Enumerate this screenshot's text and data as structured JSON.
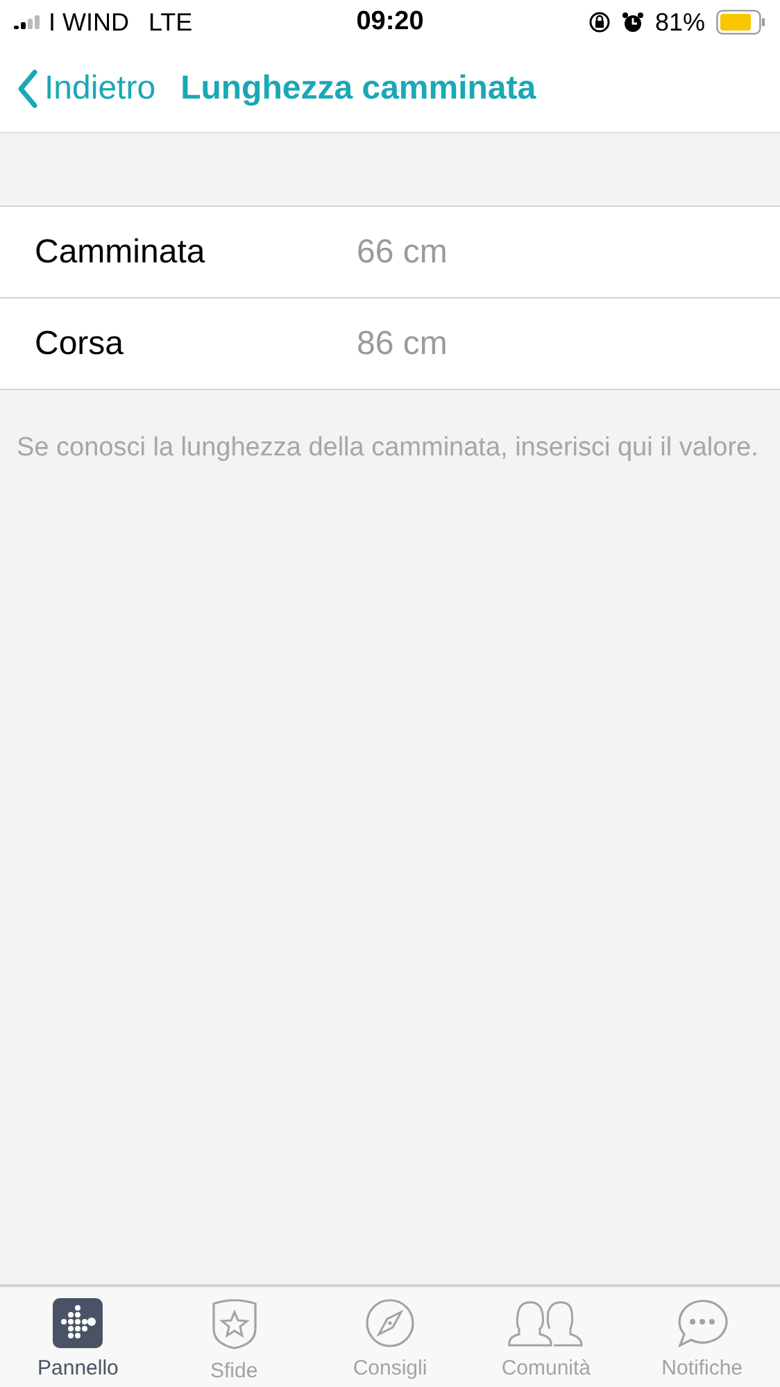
{
  "status_bar": {
    "carrier": "I WIND",
    "network": "LTE",
    "time": "09:20",
    "battery": "81%"
  },
  "nav": {
    "back": "Indietro",
    "title": "Lunghezza camminata"
  },
  "rows": [
    {
      "label": "Camminata",
      "value": "66 cm"
    },
    {
      "label": "Corsa",
      "value": "86 cm"
    }
  ],
  "note": "Se conosci la lunghezza della camminata, inserisci qui il valore.",
  "tabs": [
    {
      "label": "Pannello",
      "kind": "dashboard",
      "selected": true
    },
    {
      "label": "Sfide",
      "kind": "challenges",
      "selected": false
    },
    {
      "label": "Consigli",
      "kind": "guidance",
      "selected": false
    },
    {
      "label": "Comunità",
      "kind": "community",
      "selected": false
    },
    {
      "label": "Notifiche",
      "kind": "notifications",
      "selected": false
    }
  ]
}
